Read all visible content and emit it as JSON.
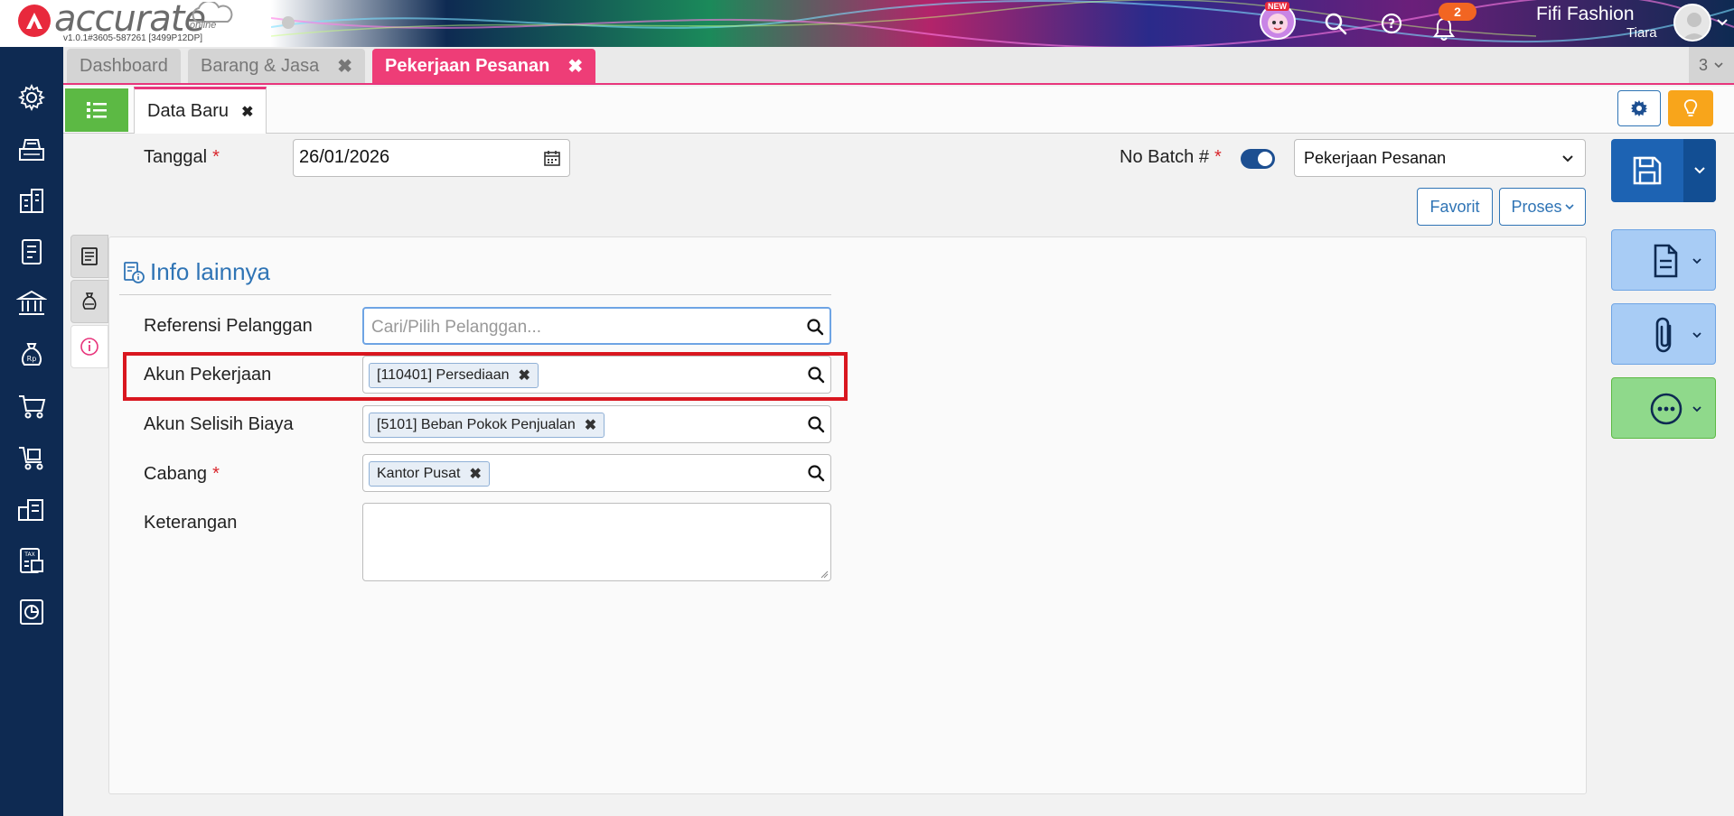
{
  "app": {
    "logo_text": "accurate",
    "logo_sub": "online",
    "version": "v1.0.1#3605-587261 [3499P12DP]"
  },
  "header": {
    "new_badge": "NEW",
    "notification_count": "2",
    "company_name": "Fifi Fashion",
    "user_name": "Tiara"
  },
  "tabs": [
    {
      "label": "Dashboard",
      "active": false
    },
    {
      "label": "Barang & Jasa",
      "active": false
    },
    {
      "label": "Pekerjaan Pesanan",
      "active": true
    }
  ],
  "tab_count": "3",
  "subtab": {
    "label": "Data Baru"
  },
  "form": {
    "date_label": "Tanggal",
    "date_value": "26/01/2026",
    "batch_label": "No Batch #",
    "batch_toggle_on": true,
    "batch_select_value": "Pekerjaan Pesanan",
    "favorit_label": "Favorit",
    "proses_label": "Proses"
  },
  "panel": {
    "title": "Info lainnya",
    "fields": {
      "referensi_label": "Referensi Pelanggan",
      "referensi_placeholder": "Cari/Pilih Pelanggan...",
      "akun_pekerjaan_label": "Akun Pekerjaan",
      "akun_pekerjaan_tag": "[110401] Persediaan",
      "akun_selisih_label": "Akun Selisih Biaya",
      "akun_selisih_tag": "[5101] Beban Pokok Penjualan",
      "cabang_label": "Cabang",
      "cabang_tag": "Kantor Pusat",
      "keterangan_label": "Keterangan",
      "keterangan_value": ""
    }
  },
  "colors": {
    "accent_pink": "#ee3d77",
    "primary_blue": "#1d63b3",
    "sidebar_bg": "#0e2a52",
    "highlight_red": "#d9161f"
  }
}
